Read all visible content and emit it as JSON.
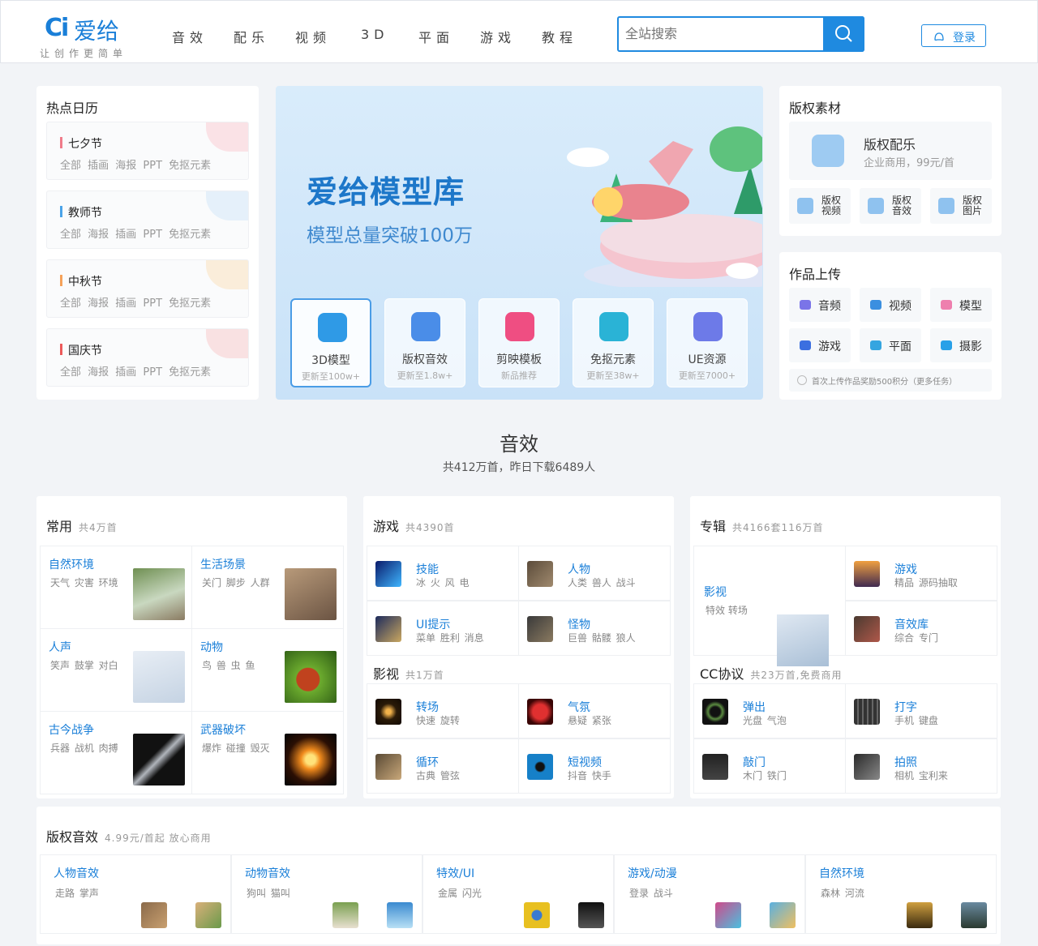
{
  "header": {
    "logo_mark": "Ci",
    "logo_text": "爱给",
    "slogan": "让创作更简单",
    "nav": [
      "音效",
      "配乐",
      "视频",
      "3D",
      "平面",
      "游戏",
      "教程"
    ],
    "search_placeholder": "全站搜索",
    "login_label": "登录"
  },
  "calendar": {
    "title": "热点日历",
    "items": [
      {
        "name": "七夕节",
        "tags": "全部 插画 海报 PPT 免抠元素",
        "color": "#f07c8a"
      },
      {
        "name": "教师节",
        "tags": "全部 海报 插画 PPT 免抠元素",
        "color": "#4aa3e8"
      },
      {
        "name": "中秋节",
        "tags": "全部 海报 插画 PPT 免抠元素",
        "color": "#f5a25a"
      },
      {
        "name": "国庆节",
        "tags": "全部 海报 插画 PPT 免抠元素",
        "color": "#ec5a5a"
      }
    ]
  },
  "banner": {
    "title": "爱给模型库",
    "subtitle": "模型总量突破100万",
    "cards": [
      {
        "name": "3D模型",
        "sub": "更新至100w+",
        "icon": "cube-icon"
      },
      {
        "name": "版权音效",
        "sub": "更新至1.8w+",
        "icon": "shield-sound-icon"
      },
      {
        "name": "剪映模板",
        "sub": "新品推荐",
        "icon": "capcut-icon"
      },
      {
        "name": "免抠元素",
        "sub": "更新至38w+",
        "icon": "cutout-icon"
      },
      {
        "name": "UE资源",
        "sub": "更新至7000+",
        "icon": "ue-folder-icon"
      }
    ]
  },
  "copyright": {
    "title": "版权素材",
    "main_name": "版权配乐",
    "main_desc": "企业商用，99元/首",
    "items": [
      {
        "label": "版权视频",
        "icon": "video-icon"
      },
      {
        "label": "版权音效",
        "icon": "sound-icon"
      },
      {
        "label": "版权图片",
        "icon": "image-icon"
      }
    ]
  },
  "upload": {
    "title": "作品上传",
    "items": [
      {
        "label": "音频",
        "icon": "audio-icon",
        "color": "#7a74e8"
      },
      {
        "label": "视频",
        "icon": "video-icon",
        "color": "#3b8fe0"
      },
      {
        "label": "模型",
        "icon": "model-icon",
        "color": "#ee7fae"
      },
      {
        "label": "游戏",
        "icon": "gamepad-icon",
        "color": "#3b6fe0"
      },
      {
        "label": "平面",
        "icon": "picture-icon",
        "color": "#35a5e0"
      },
      {
        "label": "摄影",
        "icon": "camera-icon",
        "color": "#28a0e8"
      }
    ],
    "tip": "首次上传作品奖励500积分（更多任务）"
  },
  "sound_section": {
    "title": "音效",
    "subtitle": "共412万首，昨日下载6489人"
  },
  "common": {
    "title": "常用",
    "count": "共4万首",
    "cells": [
      {
        "title": "自然环境",
        "desc": "天气 灾害 环境",
        "img": "forest-thumb"
      },
      {
        "title": "生活场景",
        "desc": "关门 脚步 人群",
        "img": "footprints-thumb"
      },
      {
        "title": "人声",
        "desc": "笑声 鼓掌 对白",
        "img": "voice-thumb"
      },
      {
        "title": "动物",
        "desc": "鸟 兽 虫 鱼",
        "img": "ladybug-thumb"
      },
      {
        "title": "古今战争",
        "desc": "兵器 战机 肉搏",
        "img": "sword-thumb"
      },
      {
        "title": "武器破坏",
        "desc": "爆炸 碰撞 毁灭",
        "img": "explosion-thumb"
      }
    ]
  },
  "game": {
    "title": "游戏",
    "count": "共4390首",
    "cells": [
      {
        "title": "技能",
        "desc": "冰 火 风 电"
      },
      {
        "title": "人物",
        "desc": "人类 兽人 战斗"
      },
      {
        "title": "UI提示",
        "desc": "菜单 胜利 消息"
      },
      {
        "title": "怪物",
        "desc": "巨兽 骷髅 狼人"
      }
    ]
  },
  "film": {
    "title": "影视",
    "count": "共1万首",
    "cells": [
      {
        "title": "转场",
        "desc": "快速 旋转"
      },
      {
        "title": "气氛",
        "desc": "悬疑 紧张"
      },
      {
        "title": "循环",
        "desc": "古典 管弦"
      },
      {
        "title": "短视频",
        "desc": "抖音 快手"
      }
    ]
  },
  "album": {
    "title": "专辑",
    "count": "共4166套116万首",
    "feature_title": "影视",
    "feature_desc": "特效 转场",
    "cells": [
      {
        "title": "游戏",
        "desc": "精品 源码抽取"
      },
      {
        "title": "音效库",
        "desc": "综合 专门"
      }
    ]
  },
  "cc": {
    "title": "CC协议",
    "count": "共23万首,免费商用",
    "cells": [
      {
        "title": "弹出",
        "desc": "光盘 气泡"
      },
      {
        "title": "打字",
        "desc": "手机 键盘"
      },
      {
        "title": "敲门",
        "desc": "木门 铁门"
      },
      {
        "title": "拍照",
        "desc": "相机 宝利来"
      }
    ]
  },
  "copyright_sound": {
    "title": "版权音效",
    "count": "4.99元/首起 放心商用",
    "cells": [
      {
        "title": "人物音效",
        "desc": "走路 掌声"
      },
      {
        "title": "动物音效",
        "desc": "狗叫 猫叫"
      },
      {
        "title": "特效/UI",
        "desc": "金属 闪光"
      },
      {
        "title": "游戏/动漫",
        "desc": "登录 战斗"
      },
      {
        "title": "自然环境",
        "desc": "森林 河流"
      }
    ]
  }
}
